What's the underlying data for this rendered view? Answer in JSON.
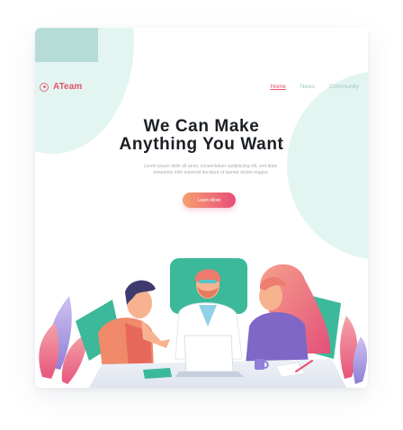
{
  "brand": {
    "name": "ATeam",
    "logo_icon": "circle-logo-icon"
  },
  "nav": {
    "items": [
      {
        "label": "Home",
        "active": true
      },
      {
        "label": "News",
        "active": false
      },
      {
        "label": "Community",
        "active": false
      }
    ]
  },
  "hero": {
    "title_line1": "We Can Make",
    "title_line2": "Anything You Want",
    "description_line1": "Lorem ipsum dolor sit amet, consectetuer vadipiscing elit, sed diam",
    "description_line2": "nonummy nibh euismod tincidunt ut laoreet dolore magna",
    "cta_label": "Learn More"
  },
  "colors": {
    "accent": "#e2526a",
    "mint": "#e3f5f1",
    "mint_dark": "#b6dcd8",
    "nav_inactive": "#9cc9c3",
    "title": "#1b1f24"
  }
}
